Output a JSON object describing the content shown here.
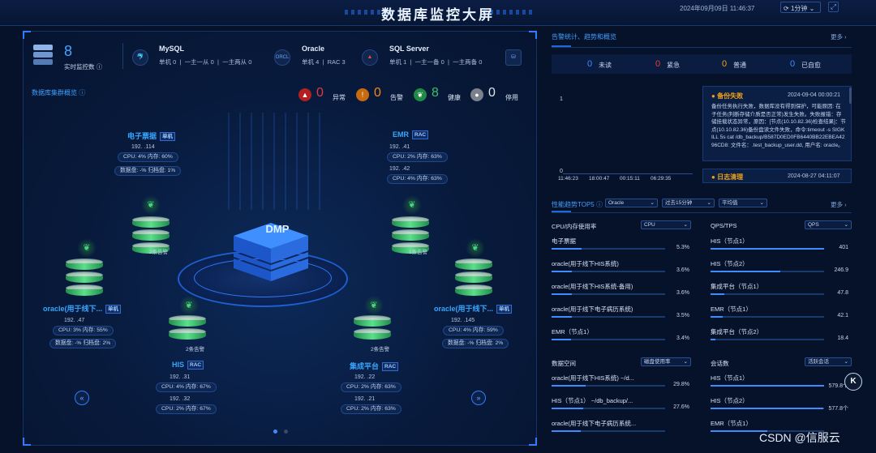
{
  "header": {
    "title": "数据库监控大屏",
    "datetime": "2024年09月09日 11:46:37",
    "interval": "1分钟"
  },
  "summary": {
    "monitor_count": "8",
    "monitor_label": "实时监控数",
    "info_icon": "info-icon",
    "dbs": [
      {
        "name": "MySQL",
        "icon": "mysql-dolphin-icon",
        "stats": [
          "单机 0",
          "一主一从 0",
          "一主两从 0"
        ]
      },
      {
        "name": "Oracle",
        "icon": "oracle-icon",
        "stats": [
          "单机 4",
          "RAC 3"
        ]
      },
      {
        "name": "SQL Server",
        "icon": "sqlserver-icon",
        "stats": [
          "单机 1",
          "一主一备 0",
          "一主两备 0"
        ]
      }
    ]
  },
  "cluster": {
    "title": "数据库集群概览",
    "legend": [
      {
        "label": "异常",
        "count": "0",
        "color": "#e23b3b",
        "icon": "error-triangle-icon"
      },
      {
        "label": "告警",
        "count": "0",
        "color": "#f08a1c",
        "icon": "warning-icon"
      },
      {
        "label": "健康",
        "count": "8",
        "color": "#39c26b",
        "icon": "leaf-icon"
      },
      {
        "label": "停用",
        "count": "0",
        "color": "#c8ccd3",
        "icon": "stop-icon"
      }
    ],
    "center_label": "DMP",
    "nodes": [
      {
        "name": "电子票据",
        "tag": "单机",
        "ips": [
          "192.          .114"
        ],
        "pills": [
          "CPU: 4% 内存: 60%",
          "数据盘: -% 归档盘: 1%"
        ],
        "alarm": ""
      },
      {
        "name": "EMR",
        "tag": "RAC",
        "ips": [
          "192.          .41",
          "192.          .42"
        ],
        "pills": [
          "CPU: 2% 内存: 63%",
          "CPU: 4% 内存: 63%"
        ],
        "alarm": ""
      },
      {
        "name": "oracle(用于线下...",
        "tag": "单机",
        "ips": [
          "192.          .47"
        ],
        "pills": [
          "CPU: 3% 内存: 55%",
          "数据盘: -% 归档盘: 2%"
        ],
        "alarm": ""
      },
      {
        "name": "oracle(用于线下...",
        "tag": "单机",
        "ips": [
          "192.          .145"
        ],
        "pills": [
          "CPU: 4% 内存: 59%",
          "数据盘: -% 归档盘: 2%"
        ],
        "alarm": ""
      },
      {
        "name": "HIS",
        "tag": "RAC",
        "ips": [
          "192.          .31",
          "192.          .32"
        ],
        "pills": [
          "CPU: 4% 内存: 67%",
          "CPU: 2% 内存: 67%"
        ],
        "alarm": ""
      },
      {
        "name": "集成平台",
        "tag": "RAC",
        "ips": [
          "192.          .22",
          "192.          .21"
        ],
        "pills": [
          "CPU: 2% 内存: 63%",
          "CPU: 2% 内存: 63%"
        ],
        "alarm": ""
      }
    ],
    "cylinder_alarms": [
      "2条告警",
      "1条告警",
      "2条告警",
      "2条告警"
    ]
  },
  "alerts": {
    "title": "告警统计、趋势和概览",
    "more": "更多",
    "counts": [
      {
        "value": "0",
        "label": "未读"
      },
      {
        "value": "0",
        "label": "紧急"
      },
      {
        "value": "0",
        "label": "普通"
      },
      {
        "value": "0",
        "label": "已自愈"
      }
    ],
    "trend_y": "1",
    "trend_x": [
      "11:46:23",
      "18:00:47",
      "00:15:11",
      "06:29:35"
    ],
    "trend_zero": "0",
    "items": [
      {
        "title": "备份失败",
        "time": "2024-09-04 00:00:21",
        "body": "备份任务执行失败，数据库没有得到保护，可能原因: 在子任务(判断存储介质是否正常)发生失败。失败报错：存储挂载状态异常，原因：[节点(10.10.82.36)检查结果]：节点(10.10.82.36)备份盘读文件失败，命令:timeout -s SIGKILL 5s cat /db_backup/B587D0ED0FB6440BB22EBEA4296CD8: 文件名：.test_backup_user.dd, 用户名: oracle。"
      },
      {
        "title": "日志清理",
        "time": "2024-08-27 04:11:07",
        "body": ""
      }
    ]
  },
  "perf": {
    "title": "性能趋势TOP5",
    "db_select": "Oracle",
    "range_select": "过去15分钟",
    "agg_select": "平均值",
    "more": "更多",
    "panels": [
      {
        "title": "CPU/内存使用率",
        "select": "CPU",
        "rows": [
          {
            "label": "电子票据",
            "value": "5.3%",
            "pct": 5.3
          },
          {
            "label": "oracle(用于线下HIS系统)",
            "value": "3.6%",
            "pct": 3.6
          },
          {
            "label": "oracle(用于线下HIS系统-备用)",
            "value": "3.6%",
            "pct": 3.6
          },
          {
            "label": "oracle(用于线下电子病历系统)",
            "value": "3.5%",
            "pct": 3.5
          },
          {
            "label": "EMR（节点1）",
            "value": "3.4%",
            "pct": 3.4
          }
        ]
      },
      {
        "title": "QPS/TPS",
        "select": "QPS",
        "rows": [
          {
            "label": "HIS（节点1）",
            "value": "401",
            "pct": 100
          },
          {
            "label": "HIS（节点2）",
            "value": "246.9",
            "pct": 61.6
          },
          {
            "label": "集成平台（节点1）",
            "value": "47.8",
            "pct": 11.9
          },
          {
            "label": "EMR（节点1）",
            "value": "42.1",
            "pct": 10.5
          },
          {
            "label": "集成平台（节点2）",
            "value": "18.4",
            "pct": 4.6
          }
        ]
      },
      {
        "title": "数据空间",
        "select": "磁盘使用率",
        "rows": [
          {
            "label": "oracle(用于线下HIS系统) ~/d...",
            "value": "29.8%",
            "pct": 29.8
          },
          {
            "label": "HIS（节点1） ~/db_backup/...",
            "value": "27.6%",
            "pct": 27.6
          },
          {
            "label": "oracle(用于线下电子病历系统...",
            "value": "",
            "pct": 26
          }
        ]
      },
      {
        "title": "会话数",
        "select": "活跃会话",
        "rows": [
          {
            "label": "HIS（节点1）",
            "value": "579.8个",
            "pct": 100
          },
          {
            "label": "HIS（节点2）",
            "value": "577.8个",
            "pct": 99.6
          },
          {
            "label": "EMR（节点1）",
            "value": "",
            "pct": 50
          }
        ]
      }
    ]
  },
  "watermark": "CSDN @信服云"
}
